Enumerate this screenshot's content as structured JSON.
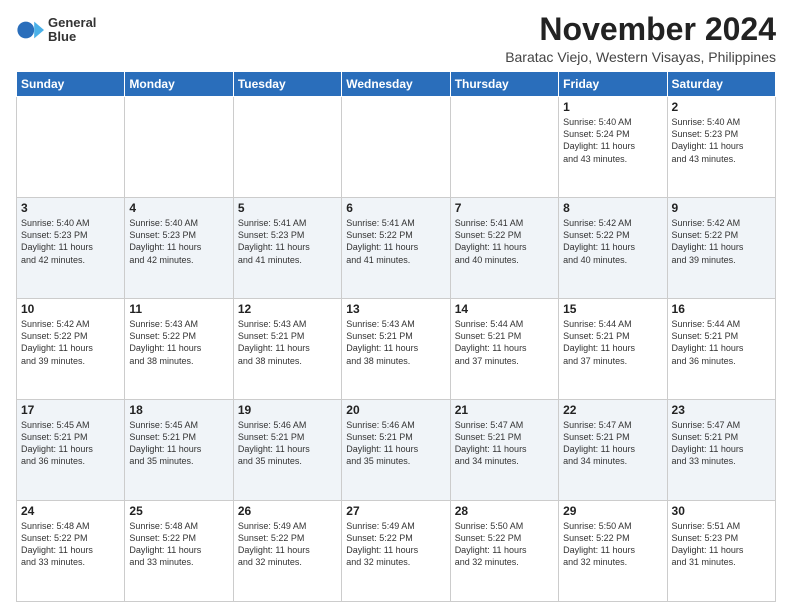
{
  "logo": {
    "line1": "General",
    "line2": "Blue"
  },
  "title": "November 2024",
  "subtitle": "Baratac Viejo, Western Visayas, Philippines",
  "weekdays": [
    "Sunday",
    "Monday",
    "Tuesday",
    "Wednesday",
    "Thursday",
    "Friday",
    "Saturday"
  ],
  "weeks": [
    [
      {
        "day": "",
        "detail": ""
      },
      {
        "day": "",
        "detail": ""
      },
      {
        "day": "",
        "detail": ""
      },
      {
        "day": "",
        "detail": ""
      },
      {
        "day": "",
        "detail": ""
      },
      {
        "day": "1",
        "detail": "Sunrise: 5:40 AM\nSunset: 5:24 PM\nDaylight: 11 hours\nand 43 minutes."
      },
      {
        "day": "2",
        "detail": "Sunrise: 5:40 AM\nSunset: 5:23 PM\nDaylight: 11 hours\nand 43 minutes."
      }
    ],
    [
      {
        "day": "3",
        "detail": "Sunrise: 5:40 AM\nSunset: 5:23 PM\nDaylight: 11 hours\nand 42 minutes."
      },
      {
        "day": "4",
        "detail": "Sunrise: 5:40 AM\nSunset: 5:23 PM\nDaylight: 11 hours\nand 42 minutes."
      },
      {
        "day": "5",
        "detail": "Sunrise: 5:41 AM\nSunset: 5:23 PM\nDaylight: 11 hours\nand 41 minutes."
      },
      {
        "day": "6",
        "detail": "Sunrise: 5:41 AM\nSunset: 5:22 PM\nDaylight: 11 hours\nand 41 minutes."
      },
      {
        "day": "7",
        "detail": "Sunrise: 5:41 AM\nSunset: 5:22 PM\nDaylight: 11 hours\nand 40 minutes."
      },
      {
        "day": "8",
        "detail": "Sunrise: 5:42 AM\nSunset: 5:22 PM\nDaylight: 11 hours\nand 40 minutes."
      },
      {
        "day": "9",
        "detail": "Sunrise: 5:42 AM\nSunset: 5:22 PM\nDaylight: 11 hours\nand 39 minutes."
      }
    ],
    [
      {
        "day": "10",
        "detail": "Sunrise: 5:42 AM\nSunset: 5:22 PM\nDaylight: 11 hours\nand 39 minutes."
      },
      {
        "day": "11",
        "detail": "Sunrise: 5:43 AM\nSunset: 5:22 PM\nDaylight: 11 hours\nand 38 minutes."
      },
      {
        "day": "12",
        "detail": "Sunrise: 5:43 AM\nSunset: 5:21 PM\nDaylight: 11 hours\nand 38 minutes."
      },
      {
        "day": "13",
        "detail": "Sunrise: 5:43 AM\nSunset: 5:21 PM\nDaylight: 11 hours\nand 38 minutes."
      },
      {
        "day": "14",
        "detail": "Sunrise: 5:44 AM\nSunset: 5:21 PM\nDaylight: 11 hours\nand 37 minutes."
      },
      {
        "day": "15",
        "detail": "Sunrise: 5:44 AM\nSunset: 5:21 PM\nDaylight: 11 hours\nand 37 minutes."
      },
      {
        "day": "16",
        "detail": "Sunrise: 5:44 AM\nSunset: 5:21 PM\nDaylight: 11 hours\nand 36 minutes."
      }
    ],
    [
      {
        "day": "17",
        "detail": "Sunrise: 5:45 AM\nSunset: 5:21 PM\nDaylight: 11 hours\nand 36 minutes."
      },
      {
        "day": "18",
        "detail": "Sunrise: 5:45 AM\nSunset: 5:21 PM\nDaylight: 11 hours\nand 35 minutes."
      },
      {
        "day": "19",
        "detail": "Sunrise: 5:46 AM\nSunset: 5:21 PM\nDaylight: 11 hours\nand 35 minutes."
      },
      {
        "day": "20",
        "detail": "Sunrise: 5:46 AM\nSunset: 5:21 PM\nDaylight: 11 hours\nand 35 minutes."
      },
      {
        "day": "21",
        "detail": "Sunrise: 5:47 AM\nSunset: 5:21 PM\nDaylight: 11 hours\nand 34 minutes."
      },
      {
        "day": "22",
        "detail": "Sunrise: 5:47 AM\nSunset: 5:21 PM\nDaylight: 11 hours\nand 34 minutes."
      },
      {
        "day": "23",
        "detail": "Sunrise: 5:47 AM\nSunset: 5:21 PM\nDaylight: 11 hours\nand 33 minutes."
      }
    ],
    [
      {
        "day": "24",
        "detail": "Sunrise: 5:48 AM\nSunset: 5:22 PM\nDaylight: 11 hours\nand 33 minutes."
      },
      {
        "day": "25",
        "detail": "Sunrise: 5:48 AM\nSunset: 5:22 PM\nDaylight: 11 hours\nand 33 minutes."
      },
      {
        "day": "26",
        "detail": "Sunrise: 5:49 AM\nSunset: 5:22 PM\nDaylight: 11 hours\nand 32 minutes."
      },
      {
        "day": "27",
        "detail": "Sunrise: 5:49 AM\nSunset: 5:22 PM\nDaylight: 11 hours\nand 32 minutes."
      },
      {
        "day": "28",
        "detail": "Sunrise: 5:50 AM\nSunset: 5:22 PM\nDaylight: 11 hours\nand 32 minutes."
      },
      {
        "day": "29",
        "detail": "Sunrise: 5:50 AM\nSunset: 5:22 PM\nDaylight: 11 hours\nand 32 minutes."
      },
      {
        "day": "30",
        "detail": "Sunrise: 5:51 AM\nSunset: 5:23 PM\nDaylight: 11 hours\nand 31 minutes."
      }
    ]
  ]
}
